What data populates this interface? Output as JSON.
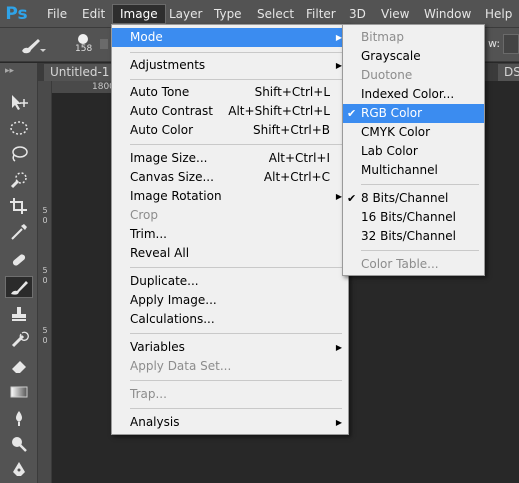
{
  "app": {
    "logo": "Ps"
  },
  "menubar": {
    "items": [
      "File",
      "Edit",
      "Image",
      "Layer",
      "Type",
      "Select",
      "Filter",
      "3D",
      "View",
      "Window",
      "Help"
    ]
  },
  "options": {
    "brush_size": "158",
    "flow_label": "w:"
  },
  "tabs": {
    "document": "Untitled-1 @",
    "right_tab": "DS"
  },
  "rulers": {
    "h_label": "1800",
    "v_labels": [
      "5",
      "0",
      "5",
      "0",
      "5",
      "0"
    ]
  },
  "image_menu": {
    "items": [
      {
        "label": "Mode",
        "submenu": true
      },
      {
        "label": "Adjustments",
        "submenu": true
      },
      {
        "label": "Auto Tone",
        "shortcut": "Shift+Ctrl+L"
      },
      {
        "label": "Auto Contrast",
        "shortcut": "Alt+Shift+Ctrl+L"
      },
      {
        "label": "Auto Color",
        "shortcut": "Shift+Ctrl+B"
      },
      {
        "label": "Image Size...",
        "shortcut": "Alt+Ctrl+I"
      },
      {
        "label": "Canvas Size...",
        "shortcut": "Alt+Ctrl+C"
      },
      {
        "label": "Image Rotation",
        "submenu": true
      },
      {
        "label": "Crop",
        "disabled": true
      },
      {
        "label": "Trim..."
      },
      {
        "label": "Reveal All"
      },
      {
        "label": "Duplicate..."
      },
      {
        "label": "Apply Image..."
      },
      {
        "label": "Calculations..."
      },
      {
        "label": "Variables",
        "submenu": true
      },
      {
        "label": "Apply Data Set...",
        "disabled": true
      },
      {
        "label": "Trap...",
        "disabled": true
      },
      {
        "label": "Analysis",
        "submenu": true
      }
    ]
  },
  "mode_menu": {
    "items": [
      {
        "label": "Bitmap",
        "disabled": true
      },
      {
        "label": "Grayscale"
      },
      {
        "label": "Duotone",
        "disabled": true
      },
      {
        "label": "Indexed Color..."
      },
      {
        "label": "RGB Color",
        "checked": true
      },
      {
        "label": "CMYK Color"
      },
      {
        "label": "Lab Color"
      },
      {
        "label": "Multichannel"
      },
      {
        "label": "8 Bits/Channel",
        "checked": true
      },
      {
        "label": "16 Bits/Channel"
      },
      {
        "label": "32 Bits/Channel"
      },
      {
        "label": "Color Table...",
        "disabled": true
      }
    ]
  },
  "glyphs": {
    "arrow": "▶",
    "check": "✔"
  },
  "colors": {
    "highlight": "#3b8cf0",
    "menu_bg": "#f0f0f0",
    "chrome": "#535353",
    "canvas": "#282828"
  }
}
